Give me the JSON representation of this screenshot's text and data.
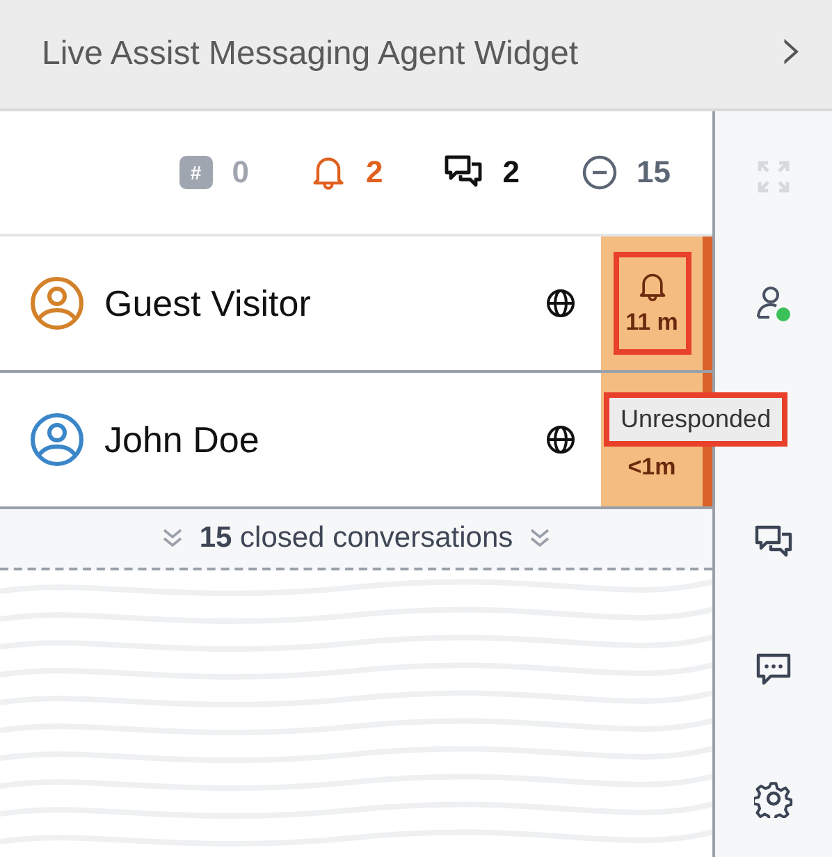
{
  "header": {
    "title": "Live Assist Messaging Agent Widget",
    "collapse_glyph": "›"
  },
  "stats": [
    {
      "kind": "hash",
      "icon_text": "#",
      "count": "0"
    },
    {
      "kind": "alert",
      "count": "2"
    },
    {
      "kind": "chat",
      "count": "2"
    },
    {
      "kind": "closed",
      "count": "15"
    }
  ],
  "conversations": [
    {
      "name": "Guest Visitor",
      "color": "#d4822a",
      "time": "11 m",
      "show_bell": true,
      "highlighted": true
    },
    {
      "name": "John Doe",
      "color": "#3a86c8",
      "time": "<1m",
      "show_bell": false,
      "highlighted": false
    }
  ],
  "tooltip": {
    "text": "Unresponded",
    "highlighted": true
  },
  "closed_bar": {
    "count": "15",
    "label": "closed conversations"
  },
  "sidebar": [
    {
      "kind": "expand",
      "disabled": true
    },
    {
      "kind": "agent",
      "online": true
    },
    {
      "kind": "chats"
    },
    {
      "kind": "message"
    },
    {
      "kind": "settings"
    }
  ]
}
